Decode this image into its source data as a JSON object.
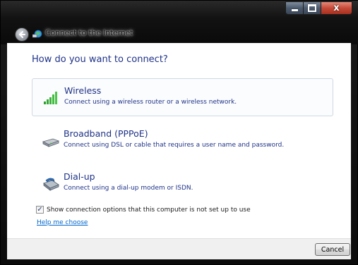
{
  "window": {
    "title": "Connect to the Internet",
    "close_glyph": "x"
  },
  "main": {
    "heading": "How do you want to connect?",
    "options": [
      {
        "title": "Wireless",
        "description": "Connect using a wireless router or a wireless network.",
        "icon": "wireless-signal-icon",
        "selected": true
      },
      {
        "title": "Broadband (PPPoE)",
        "description": "Connect using DSL or cable that requires a user name and password.",
        "icon": "broadband-modem-icon",
        "selected": false
      },
      {
        "title": "Dial-up",
        "description": "Connect using a dial-up modem or ISDN.",
        "icon": "dialup-phone-icon",
        "selected": false
      }
    ],
    "show_options_checkbox": {
      "label": "Show connection options that this computer is not set up to use",
      "checked": true
    },
    "help_link": "Help me choose"
  },
  "footer": {
    "cancel_label": "Cancel"
  },
  "colors": {
    "heading": "#1e3287",
    "link": "#0066cc",
    "close_button": "#c74a38"
  }
}
